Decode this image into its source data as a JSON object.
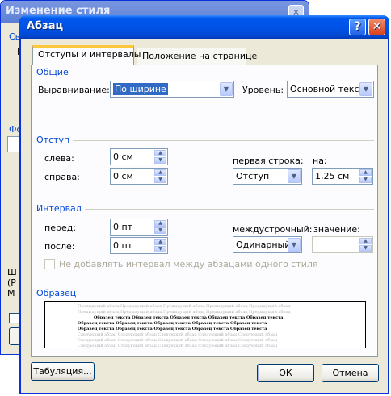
{
  "bg_dialog": {
    "title": "Изменение стиля",
    "fragments": [
      "Сво",
      "И",
      "Фо",
      "Ш",
      "(Р",
      "М"
    ],
    "close_glyph": "✕"
  },
  "dialog": {
    "title": "Абзац",
    "help_glyph": "?",
    "close_glyph": "✕"
  },
  "tabs": [
    {
      "label": "Отступы и интервалы",
      "active": true
    },
    {
      "label": "Положение на странице",
      "active": false
    }
  ],
  "general": {
    "section": "Общие",
    "alignment_label": "Выравнивание:",
    "alignment_value": "По ширине",
    "level_label": "Уровень:",
    "level_value": "Основной текст"
  },
  "indent": {
    "section": "Отступ",
    "left_label": "слева:",
    "left_value": "0 см",
    "right_label": "справа:",
    "right_value": "0 см",
    "first_line_label": "первая строка:",
    "first_line_value": "Отступ",
    "by_label": "на:",
    "by_value": "1,25 см"
  },
  "spacing": {
    "section": "Интервал",
    "before_label": "перед:",
    "before_value": "0 пт",
    "after_label": "после:",
    "after_value": "0 пт",
    "line_label": "междустрочный:",
    "line_value": "Одинарный",
    "at_label": "значение:",
    "at_value": "",
    "no_space_label": "Не добавлять интервал между абзацами одного стиля",
    "no_space_checked": false
  },
  "preview": {
    "section": "Образец",
    "prev_line": "Предыдущий абзац Предыдущий абзац Предыдущий абзац Предыдущий абзац Предыдущий абзац",
    "sample_line": "Образец текста Образец текста Образец текста Образец текста Образец текста",
    "next_line": "Следующий абзац Следующий абзац Следующий абзац Следующий абзац Следующий абзац"
  },
  "buttons": {
    "tabs": "Табуляция...",
    "ok": "ОК",
    "cancel": "Отмена"
  },
  "colors": {
    "title_bar": "#0052e4",
    "section_text": "#0046d5",
    "selection": "#316ac5",
    "dialog_bg": "#ece9d8"
  }
}
